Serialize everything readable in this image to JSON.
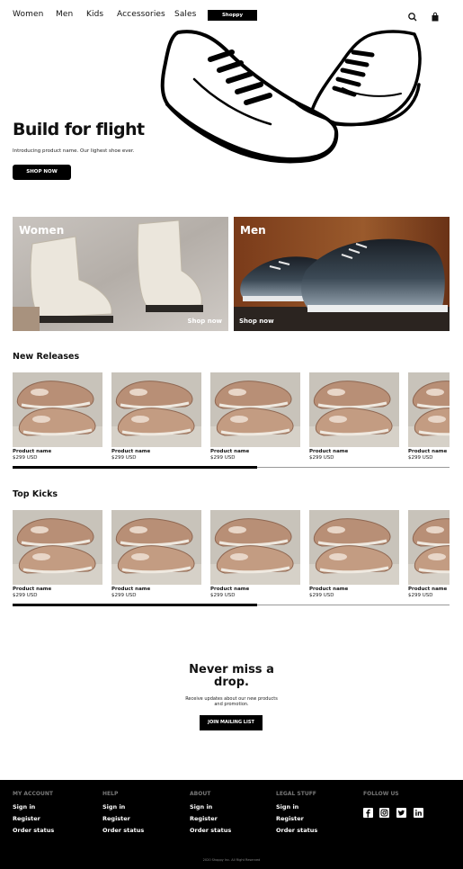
{
  "nav": {
    "items": [
      "Women",
      "Men",
      "Kids",
      "Accessories",
      "Sales"
    ],
    "logo": "Shoppy",
    "search_icon": "search-icon",
    "bag_icon": "shopping-bag-icon"
  },
  "hero": {
    "title": "Build for flight",
    "subtitle": "Introducing product name. Our lighest shoe ever.",
    "cta": "SHOP NOW"
  },
  "categories": [
    {
      "title": "Women",
      "cta": "Shop now"
    },
    {
      "title": "Men",
      "cta": "Shop now"
    }
  ],
  "new_releases": {
    "title": "New Releases",
    "products": [
      {
        "name": "Product name",
        "price": "$299 USD"
      },
      {
        "name": "Product name",
        "price": "$299 USD"
      },
      {
        "name": "Product name",
        "price": "$299 USD"
      },
      {
        "name": "Product name",
        "price": "$299 USD"
      },
      {
        "name": "Product name",
        "price": "$299 USD"
      }
    ],
    "scroll_position": 0.56
  },
  "top_kicks": {
    "title": "Top Kicks",
    "products": [
      {
        "name": "Product name",
        "price": "$299 USD"
      },
      {
        "name": "Product name",
        "price": "$299 USD"
      },
      {
        "name": "Product name",
        "price": "$299 USD"
      },
      {
        "name": "Product name",
        "price": "$299 USD"
      },
      {
        "name": "Product name",
        "price": "$299 USD"
      }
    ],
    "scroll_position": 0.56
  },
  "newsletter": {
    "title_line1": "Never miss a",
    "title_line2": "drop.",
    "text_line1": "Receive updates about our new products",
    "text_line2": "and promotion.",
    "cta": "JOIN MAILING LIST"
  },
  "footer": {
    "columns": [
      {
        "heading": "MY ACCOUNT",
        "links": [
          "Sign in",
          "Register",
          "Order status"
        ]
      },
      {
        "heading": "HELP",
        "links": [
          "Sign in",
          "Register",
          "Order status"
        ]
      },
      {
        "heading": "ABOUT",
        "links": [
          "Sign in",
          "Register",
          "Order status"
        ]
      },
      {
        "heading": "LEGAL STUFF",
        "links": [
          "Sign in",
          "Register",
          "Order status"
        ]
      }
    ],
    "follow_heading": "FOLLOW US",
    "socials": [
      "facebook-icon",
      "instagram-icon",
      "twitter-icon",
      "linkedin-icon"
    ],
    "copyright": "2020 Shoppy Inc. All Right Reserved"
  },
  "colors": {
    "primary": "#000000",
    "background": "#ffffff",
    "muted": "#777777"
  }
}
